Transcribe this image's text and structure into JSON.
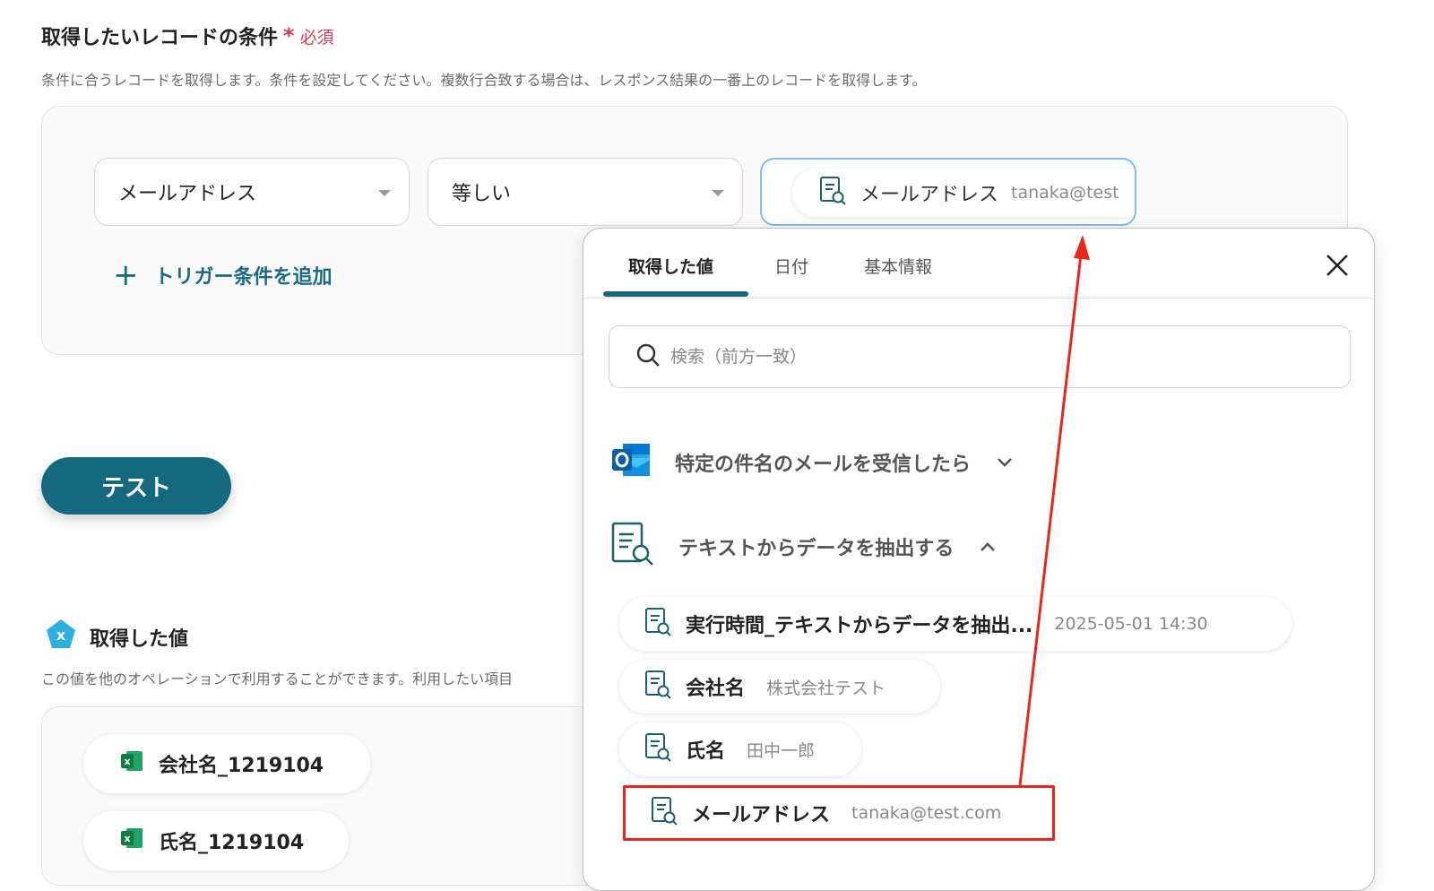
{
  "condition": {
    "title": "取得したいレコードの条件",
    "required_star": "*",
    "required_label": "必須",
    "description": "条件に合うレコードを取得します。条件を設定してください。複数行合致する場合は、レスポンス結果の一番上のレコードを取得します。",
    "field_select": "メールアドレス",
    "operator_select": "等しい",
    "value_chip_label": "メールアドレス",
    "value_chip_value": "tanaka@test",
    "add_trigger_plus": "+",
    "add_trigger_label": "トリガー条件を追加"
  },
  "test_button": "テスト",
  "obtained": {
    "title": "取得した値",
    "badge": "x",
    "description": "この値を他のオペレーションで利用することができます。利用したい項目",
    "chips": [
      "会社名_1219104",
      "氏名_1219104"
    ]
  },
  "popup": {
    "tabs": [
      "取得した値",
      "日付",
      "基本情報"
    ],
    "search_placeholder": "検索（前方一致）",
    "groups": [
      {
        "label": "特定の件名のメールを受信したら",
        "state": "collapsed"
      },
      {
        "label": "テキストからデータを抽出する",
        "state": "expanded"
      }
    ],
    "items": [
      {
        "name": "実行時間_テキストからデータを抽出...",
        "value": "2025-05-01 14:30"
      },
      {
        "name": "会社名",
        "value": "株式会社テスト"
      },
      {
        "name": "氏名",
        "value": "田中一郎"
      },
      {
        "name": "メールアドレス",
        "value": "tanaka@test.com"
      }
    ]
  },
  "colors": {
    "accent": "#15697f",
    "required": "#e53b4f",
    "highlight": "#e8261a",
    "focus_border": "#7ec0e6"
  },
  "icons": [
    "extract-doc-icon",
    "outlook-icon",
    "excel-icon",
    "search-icon",
    "close-icon",
    "chevron-down-icon",
    "chevron-up-icon",
    "plus-icon"
  ]
}
